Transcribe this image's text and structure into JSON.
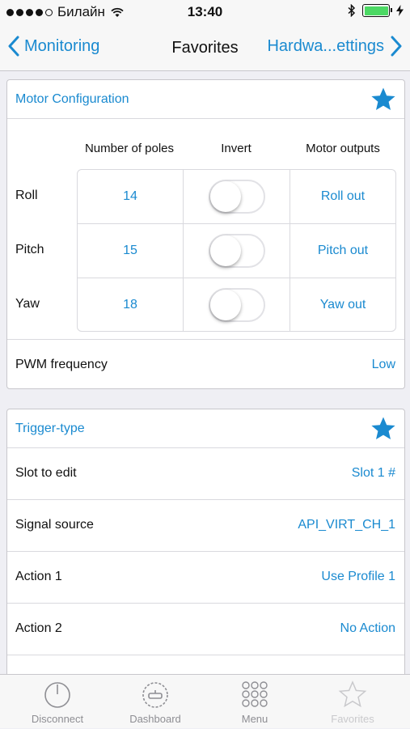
{
  "status": {
    "carrier": "Билайн",
    "time": "13:40"
  },
  "nav": {
    "back_label": "Monitoring",
    "title": "Favorites",
    "forward_label": "Hardwa...ettings"
  },
  "motor": {
    "title": "Motor Configuration",
    "col_poles": "Number of poles",
    "col_invert": "Invert",
    "col_outputs": "Motor outputs",
    "rows": [
      {
        "label": "Roll",
        "poles": "14",
        "invert": false,
        "output": "Roll out"
      },
      {
        "label": "Pitch",
        "poles": "15",
        "invert": false,
        "output": "Pitch out"
      },
      {
        "label": "Yaw",
        "poles": "18",
        "invert": false,
        "output": "Yaw out"
      }
    ],
    "pwm_label": "PWM frequency",
    "pwm_value": "Low"
  },
  "trigger": {
    "title": "Trigger-type",
    "rows": [
      {
        "label": "Slot to edit",
        "value": "Slot 1 #"
      },
      {
        "label": "Signal source",
        "value": "API_VIRT_CH_1"
      },
      {
        "label": "Action 1",
        "value": "Use Profile 1"
      },
      {
        "label": "Action 2",
        "value": "No Action"
      }
    ]
  },
  "tabs": [
    {
      "label": "Disconnect",
      "icon": "power-icon"
    },
    {
      "label": "Dashboard",
      "icon": "dashboard-icon"
    },
    {
      "label": "Menu",
      "icon": "grid-icon"
    },
    {
      "label": "Favorites",
      "icon": "star-icon"
    }
  ],
  "colors": {
    "accent": "#1a8ad0",
    "battery": "#4cd964",
    "tab_inactive": "#8e8e93"
  }
}
